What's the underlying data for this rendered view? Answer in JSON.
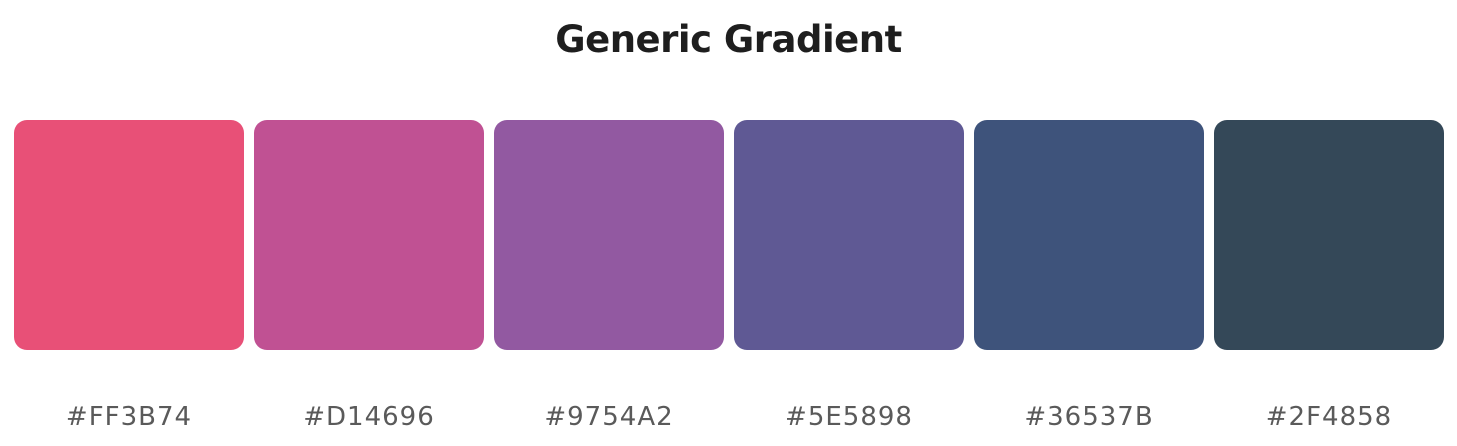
{
  "title": "Generic Gradient",
  "swatches": [
    {
      "label": "#FF3B74",
      "display_color": "#E85077"
    },
    {
      "label": "#D14696",
      "display_color": "#C05193"
    },
    {
      "label": "#9754A2",
      "display_color": "#9259A1"
    },
    {
      "label": "#5E5898",
      "display_color": "#5F5994"
    },
    {
      "label": "#36537B",
      "display_color": "#3E537B"
    },
    {
      "label": "#2F4858",
      "display_color": "#344858"
    }
  ]
}
